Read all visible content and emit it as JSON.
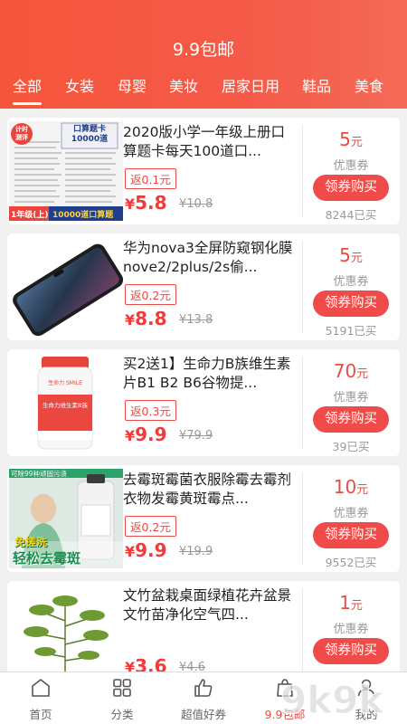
{
  "header": {
    "title": "9.9包邮",
    "tabs": [
      "全部",
      "女装",
      "母婴",
      "美妆",
      "居家日用",
      "鞋品",
      "美食"
    ],
    "accent": "#f5553a"
  },
  "products": [
    {
      "name": "2020版小学一年级上册口算题卡每天100道口...",
      "rebate": "返0.1元",
      "price_symbol": "¥",
      "price": "5.8",
      "original": "¥10.8",
      "coupon_value": "5",
      "coupon_unit": "元",
      "coupon_label": "优惠券",
      "buy_label": "领券购买",
      "sold": "8244已买",
      "thumb": {
        "badge_top": "计时",
        "badge_bottom": "测评",
        "card_title": "口算题卡",
        "card_sub": "10000道",
        "banner_grade": "1年级(上)",
        "banner_text": "10000道口算题"
      }
    },
    {
      "name": "华为nova3全屏防窥钢化膜nove2/2plus/2s偷...",
      "rebate": "返0.2元",
      "price_symbol": "¥",
      "price": "8.8",
      "original": "¥13.8",
      "coupon_value": "5",
      "coupon_unit": "元",
      "coupon_label": "优惠券",
      "buy_label": "领券购买",
      "sold": "5191已买"
    },
    {
      "name": "买2送1】生命力B族维生素片B1 B2 B6谷物提...",
      "rebate": "返0.3元",
      "price_symbol": "¥",
      "price": "9.9",
      "original": "¥79.9",
      "coupon_value": "70",
      "coupon_unit": "元",
      "coupon_label": "优惠券",
      "buy_label": "领券购买",
      "sold": "39已买",
      "thumb": {
        "brand": "生命力 SMILE",
        "label": "生命力维生素B族"
      }
    },
    {
      "name": "去霉斑霉菌衣服除霉去霉剂衣物发霉黄斑霉点...",
      "rebate": "返0.2元",
      "price_symbol": "¥",
      "price": "9.9",
      "original": "¥19.9",
      "coupon_value": "10",
      "coupon_unit": "元",
      "coupon_label": "优惠券",
      "buy_label": "领券购买",
      "sold": "9552已买",
      "thumb": {
        "top_text": "可除99种顽固污渍",
        "mid_text": "免搓洗",
        "bottom_text": "轻松去霉斑"
      }
    },
    {
      "name": "文竹盆栽桌面绿植花卉盆景文竹苗净化空气四...",
      "rebate": "",
      "price_symbol": "¥",
      "price": "3.6",
      "original": "¥4.6",
      "coupon_value": "1",
      "coupon_unit": "元",
      "coupon_label": "优惠券",
      "buy_label": "领券购买",
      "sold": ""
    }
  ],
  "tabbar": {
    "items": [
      {
        "label": "首页",
        "icon": "home-icon"
      },
      {
        "label": "分类",
        "icon": "grid-icon"
      },
      {
        "label": "超值好券",
        "icon": "thumbs-up-icon"
      },
      {
        "label": "9.9包邮",
        "icon": "bag-icon"
      },
      {
        "label": "我的",
        "icon": "user-icon"
      }
    ]
  },
  "watermark": "9k9k"
}
